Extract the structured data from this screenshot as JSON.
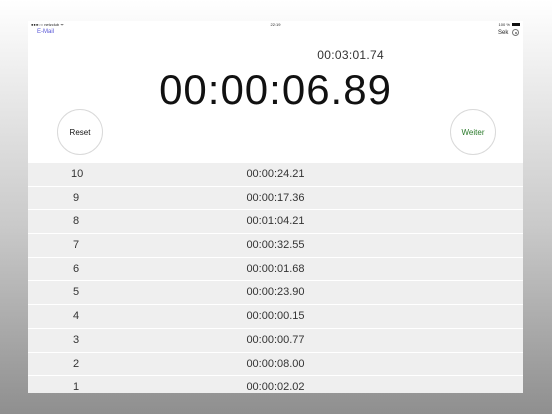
{
  "statusbar": {
    "carrier": "●●●○○ netzclub ᯤ",
    "time": "22:19",
    "battery": "100 %"
  },
  "nav": {
    "back_label": "E-Mail",
    "sek_label": "Sek",
    "settings_icon": "gear-icon"
  },
  "stopwatch": {
    "lap_time": "00:03:01.74",
    "main_time": "00:00:06.89",
    "reset_label": "Reset",
    "continue_label": "Weiter"
  },
  "laps": [
    {
      "num": "10",
      "time": "00:00:24.21"
    },
    {
      "num": "9",
      "time": "00:00:17.36"
    },
    {
      "num": "8",
      "time": "00:01:04.21"
    },
    {
      "num": "7",
      "time": "00:00:32.55"
    },
    {
      "num": "6",
      "time": "00:00:01.68"
    },
    {
      "num": "5",
      "time": "00:00:23.90"
    },
    {
      "num": "4",
      "time": "00:00:00.15"
    },
    {
      "num": "3",
      "time": "00:00:00.77"
    },
    {
      "num": "2",
      "time": "00:00:08.00"
    },
    {
      "num": "1",
      "time": "00:00:02.02"
    }
  ],
  "colors": {
    "accent": "#5856d6",
    "continue": "#2a7a2a",
    "list_bg": "#efefef"
  }
}
